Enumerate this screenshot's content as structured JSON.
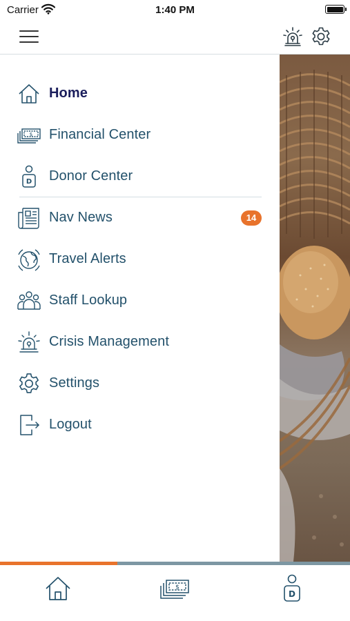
{
  "status_bar": {
    "carrier": "Carrier",
    "time": "1:40 PM",
    "wifi_icon": "wifi-icon",
    "battery_icon": "battery-full-icon"
  },
  "header": {
    "menu_icon": "hamburger-menu-icon",
    "alert_icon": "siren-alert-icon",
    "settings_icon": "gear-icon"
  },
  "menu": {
    "items": [
      {
        "label": "Home",
        "icon": "house-icon",
        "active": true
      },
      {
        "label": "Financial Center",
        "icon": "money-stack-icon"
      },
      {
        "label": "Donor Center",
        "icon": "donor-person-icon"
      },
      {
        "label": "Nav News",
        "icon": "newspaper-icon",
        "badge": "14"
      },
      {
        "label": "Travel Alerts",
        "icon": "globe-alert-icon"
      },
      {
        "label": "Staff Lookup",
        "icon": "people-group-icon"
      },
      {
        "label": "Crisis Management",
        "icon": "siren-alert-icon"
      },
      {
        "label": "Settings",
        "icon": "gear-icon"
      },
      {
        "label": "Logout",
        "icon": "logout-door-icon"
      }
    ]
  },
  "progress": {
    "fraction": 0.335
  },
  "tab_bar": {
    "tabs": [
      {
        "icon": "house-icon"
      },
      {
        "icon": "money-stack-icon"
      },
      {
        "icon": "donor-person-icon"
      }
    ]
  },
  "colors": {
    "accent_orange": "#e8732c",
    "text_primary": "#23516b",
    "active_text": "#1b1e5c",
    "track_gray": "#7d97a3"
  }
}
